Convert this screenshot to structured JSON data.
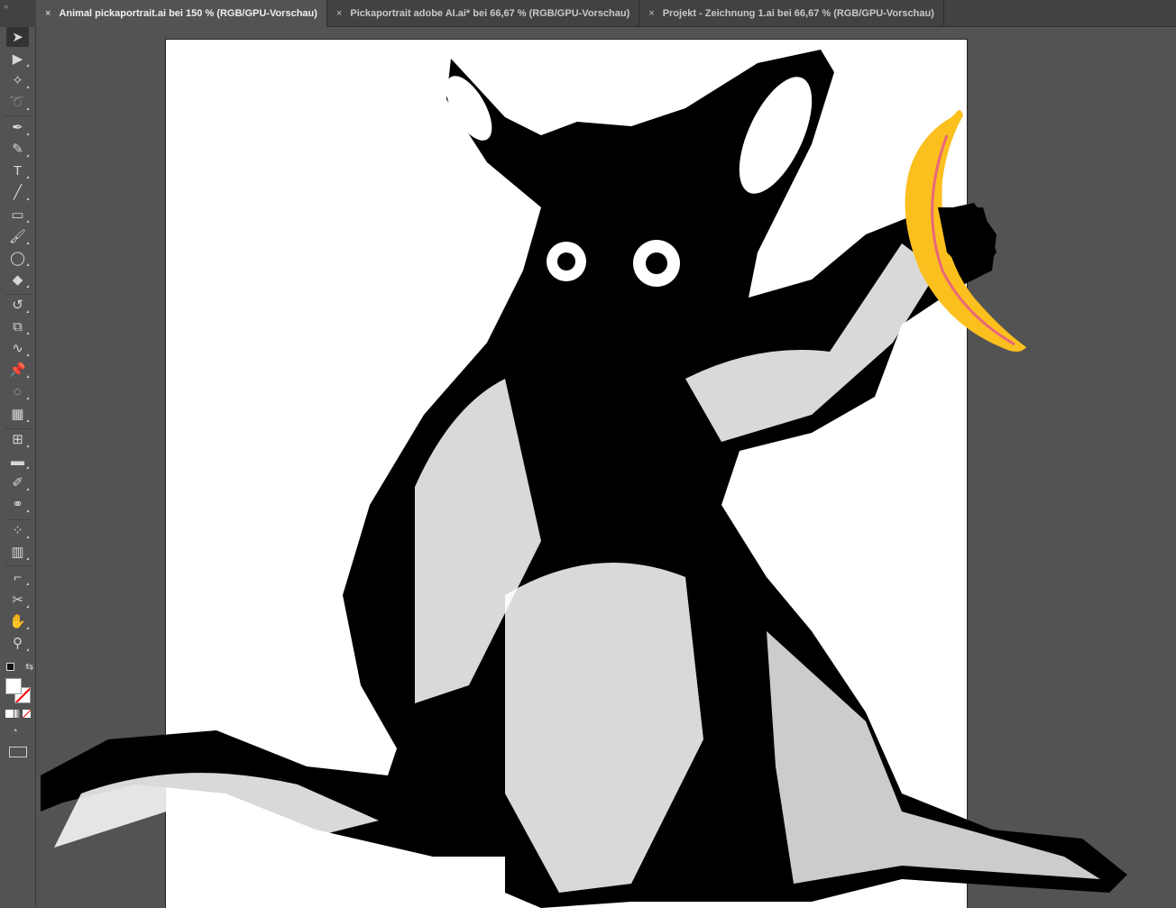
{
  "tabs": [
    {
      "label": "Animal pickaportrait.ai bei 150 % (RGB/GPU-Vorschau)",
      "active": true
    },
    {
      "label": "Pickaportrait adobe AI.ai* bei 66,67 % (RGB/GPU-Vorschau)",
      "active": false
    },
    {
      "label": "Projekt - Zeichnung 1.ai bei 66,67 % (RGB/GPU-Vorschau)",
      "active": false
    }
  ],
  "tab_close_glyph": "×",
  "toolbar_grip": "»",
  "tools": [
    {
      "name": "selection-tool",
      "glyph": "➤"
    },
    {
      "name": "direct-selection-tool",
      "glyph": "▶"
    },
    {
      "name": "magic-wand-tool",
      "glyph": "✧"
    },
    {
      "name": "lasso-tool",
      "glyph": "➰"
    },
    {
      "name": "pen-tool",
      "glyph": "✒"
    },
    {
      "name": "curvature-tool",
      "glyph": "✎"
    },
    {
      "name": "type-tool",
      "glyph": "T"
    },
    {
      "name": "line-tool",
      "glyph": "╱"
    },
    {
      "name": "rectangle-tool",
      "glyph": "▭"
    },
    {
      "name": "paintbrush-tool",
      "glyph": "🖌"
    },
    {
      "name": "shaper-tool",
      "glyph": "◯"
    },
    {
      "name": "eraser-tool",
      "glyph": "◆"
    },
    {
      "name": "rotate-tool",
      "glyph": "↺"
    },
    {
      "name": "scale-tool",
      "glyph": "⧉"
    },
    {
      "name": "warp-tool",
      "glyph": "∿"
    },
    {
      "name": "puppet-warp-tool",
      "glyph": "📌"
    },
    {
      "name": "shape-builder-tool",
      "glyph": "◌"
    },
    {
      "name": "perspective-grid-tool",
      "glyph": "▦"
    },
    {
      "name": "mesh-tool",
      "glyph": "⊞"
    },
    {
      "name": "gradient-tool",
      "glyph": "▬"
    },
    {
      "name": "eyedropper-tool",
      "glyph": "✐"
    },
    {
      "name": "blend-tool",
      "glyph": "⚭"
    },
    {
      "name": "symbol-sprayer-tool",
      "glyph": "⁘"
    },
    {
      "name": "column-graph-tool",
      "glyph": "▥"
    },
    {
      "name": "artboard-tool",
      "glyph": "⌐"
    },
    {
      "name": "slice-tool",
      "glyph": "✂"
    },
    {
      "name": "hand-tool",
      "glyph": "✋"
    },
    {
      "name": "zoom-tool",
      "glyph": "⚲"
    }
  ],
  "colors": {
    "banana": "#fbbf1e",
    "banana_stripe": "#e8677a",
    "ink": "#000000"
  }
}
